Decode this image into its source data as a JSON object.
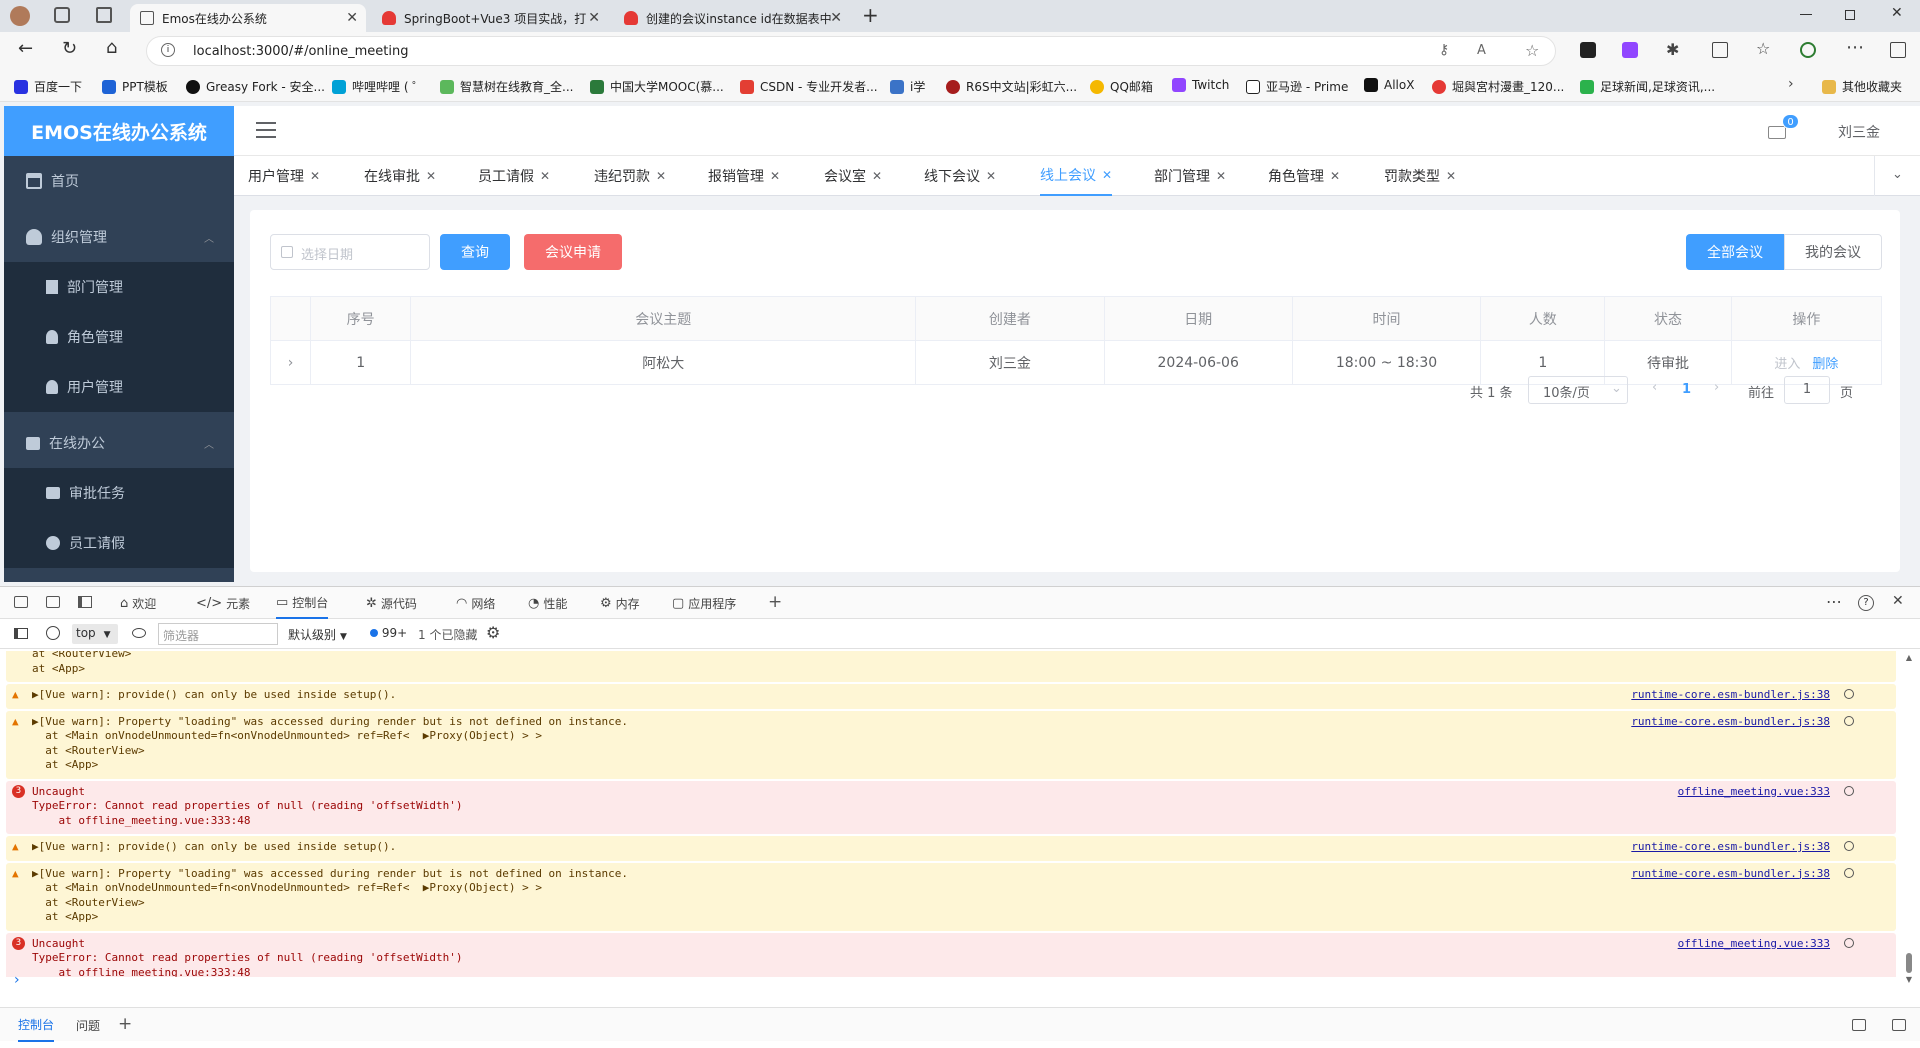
{
  "browser": {
    "tabs": [
      {
        "title": "Emos在线办公系统",
        "active": true
      },
      {
        "title": "SpringBoot+Vue3 项目实战，打"
      },
      {
        "title": "创建的会议instance id在数据表中"
      }
    ],
    "url": "localhost:3000/#/online_meeting",
    "bookmarks": [
      "百度一下",
      "PPT模板",
      "Greasy Fork - 安全...",
      "哔哩哔哩 ( ゜",
      "智慧树在线教育_全...",
      "中国大学MOOC(慕...",
      "CSDN - 专业开发者...",
      "i学",
      "R6S中文站|彩虹六...",
      "QQ邮箱",
      "Twitch",
      "亚马逊 - Prime",
      "AlloX",
      "堀與宮村漫畫_120...",
      "足球新闻,足球资讯,..."
    ],
    "other_bookmarks": "其他收藏夹"
  },
  "app": {
    "logo": "EMOS在线办公系统",
    "sidebar": [
      {
        "label": "首页"
      },
      {
        "label": "组织管理"
      },
      {
        "label": "部门管理"
      },
      {
        "label": "角色管理"
      },
      {
        "label": "用户管理"
      },
      {
        "label": "在线办公"
      },
      {
        "label": "审批任务"
      },
      {
        "label": "员工请假"
      }
    ],
    "header": {
      "user": "刘三金",
      "mail_badge": "0"
    },
    "tags": [
      "用户管理",
      "在线审批",
      "员工请假",
      "违纪罚款",
      "报销管理",
      "会议室",
      "线下会议",
      "线上会议",
      "部门管理",
      "角色管理",
      "罚款类型"
    ],
    "active_tag": "线上会议",
    "toolbar": {
      "date_placeholder": "选择日期",
      "query": "查询",
      "apply": "会议申请",
      "all_meetings": "全部会议",
      "my_meetings": "我的会议"
    },
    "table": {
      "headers": [
        "序号",
        "会议主题",
        "创建者",
        "日期",
        "时间",
        "人数",
        "状态",
        "操作"
      ],
      "rows": [
        {
          "index": "1",
          "topic": "阿松大",
          "creator": "刘三金",
          "date": "2024-06-06",
          "time": "18:00 ~ 18:30",
          "count": "1",
          "status": "待审批",
          "enter": "进入",
          "delete": "删除"
        }
      ]
    },
    "pagination": {
      "total": "共 1 条",
      "page_size": "10条/页",
      "current": "1",
      "goto_label": "前往",
      "goto_value": "1",
      "page_suffix": "页"
    }
  },
  "devtools": {
    "tabs": [
      "欢迎",
      "元素",
      "控制台",
      "源代码",
      "网络",
      "性能",
      "内存",
      "应用程序"
    ],
    "filter": {
      "context": "top",
      "placeholder": "筛选器",
      "level": "默认级别",
      "issues": "99+",
      "hidden": "1 个已隐藏"
    },
    "messages": [
      {
        "type": "warn",
        "lines": [
          "at <RouterView>",
          "at <App>"
        ],
        "src": ""
      },
      {
        "type": "warn",
        "lines": [
          "▶[Vue warn]: provide() can only be used inside setup()."
        ],
        "src": "runtime-core.esm-bundler.js:38"
      },
      {
        "type": "warn",
        "lines": [
          "▶[Vue warn]: Property \"loading\" was accessed during render but is not defined on instance.",
          "  at <Main onVnodeUnmounted=fn<onVnodeUnmounted> ref=Ref<  ▶Proxy(Object) > >",
          "  at <RouterView>",
          "  at <App>"
        ],
        "src": "runtime-core.esm-bundler.js:38"
      },
      {
        "type": "err",
        "lines": [
          "Uncaught",
          "TypeError: Cannot read properties of null (reading 'offsetWidth')",
          "    at offline_meeting.vue:333:48"
        ],
        "src": "offline_meeting.vue:333"
      },
      {
        "type": "warn",
        "lines": [
          "▶[Vue warn]: provide() can only be used inside setup()."
        ],
        "src": "runtime-core.esm-bundler.js:38"
      },
      {
        "type": "warn",
        "lines": [
          "▶[Vue warn]: Property \"loading\" was accessed during render but is not defined on instance.",
          "  at <Main onVnodeUnmounted=fn<onVnodeUnmounted> ref=Ref<  ▶Proxy(Object) > >",
          "  at <RouterView>",
          "  at <App>"
        ],
        "src": "runtime-core.esm-bundler.js:38"
      },
      {
        "type": "err",
        "lines": [
          "Uncaught",
          "TypeError: Cannot read properties of null (reading 'offsetWidth')",
          "    at offline_meeting.vue:333:48"
        ],
        "src": "offline_meeting.vue:333"
      }
    ],
    "error_badge": "3",
    "bottom_tabs": [
      "控制台",
      "问题"
    ]
  },
  "colors": {
    "primary": "#409eff",
    "danger": "#f56c6c",
    "sidebar": "#304156",
    "warn_bg": "#fef6d5",
    "err_bg": "#fde9ea"
  }
}
